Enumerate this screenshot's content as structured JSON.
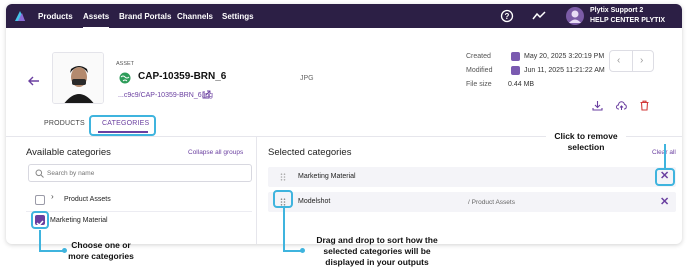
{
  "topbar": {
    "nav": [
      "Products",
      "Assets",
      "Brand Portals",
      "Channels",
      "Settings"
    ],
    "active": "Assets",
    "user_name": "Plytix Support 2",
    "user_org": "HELP CENTER PLYTIX",
    "icons": [
      "plytix-logo-icon",
      "help-icon",
      "activity-icon",
      "avatar-icon"
    ]
  },
  "asset": {
    "label": "ASSET",
    "name": "CAP-10359-BRN_6",
    "link": "...c9c9/CAP-10359-BRN_6.jpg",
    "filetype": "JPG"
  },
  "meta": {
    "created_label": "Created",
    "created_value": "May 20, 2025 3:20:19 PM",
    "modified_label": "Modified",
    "modified_value": "Jun 11, 2025 11:21:22 AM",
    "filesize_label": "File size",
    "filesize_value": "0.44 MB"
  },
  "tabs": {
    "products": "PRODUCTS",
    "categories": "CATEGORIES"
  },
  "available": {
    "title": "Available categories",
    "collapse": "Collapse all groups",
    "search_placeholder": "Search by name",
    "items": [
      "Product Assets",
      "Marketing Material"
    ]
  },
  "selected": {
    "title": "Selected categories",
    "clear": "Clear all",
    "items": [
      {
        "label": "Marketing Material",
        "path": ""
      },
      {
        "label": "Modelshot",
        "path": "/ Product Assets"
      }
    ]
  },
  "callouts": {
    "remove": [
      "Click to remove",
      "selection"
    ],
    "choose": [
      "Choose one or",
      "more categories"
    ],
    "drag": [
      "Drag and drop to sort how the",
      "selected categories will be",
      "displayed in your outputs"
    ]
  },
  "colors": {
    "topbar": "#2c1f45",
    "accent": "#6a3fa0",
    "callout": "#3fb4de"
  }
}
